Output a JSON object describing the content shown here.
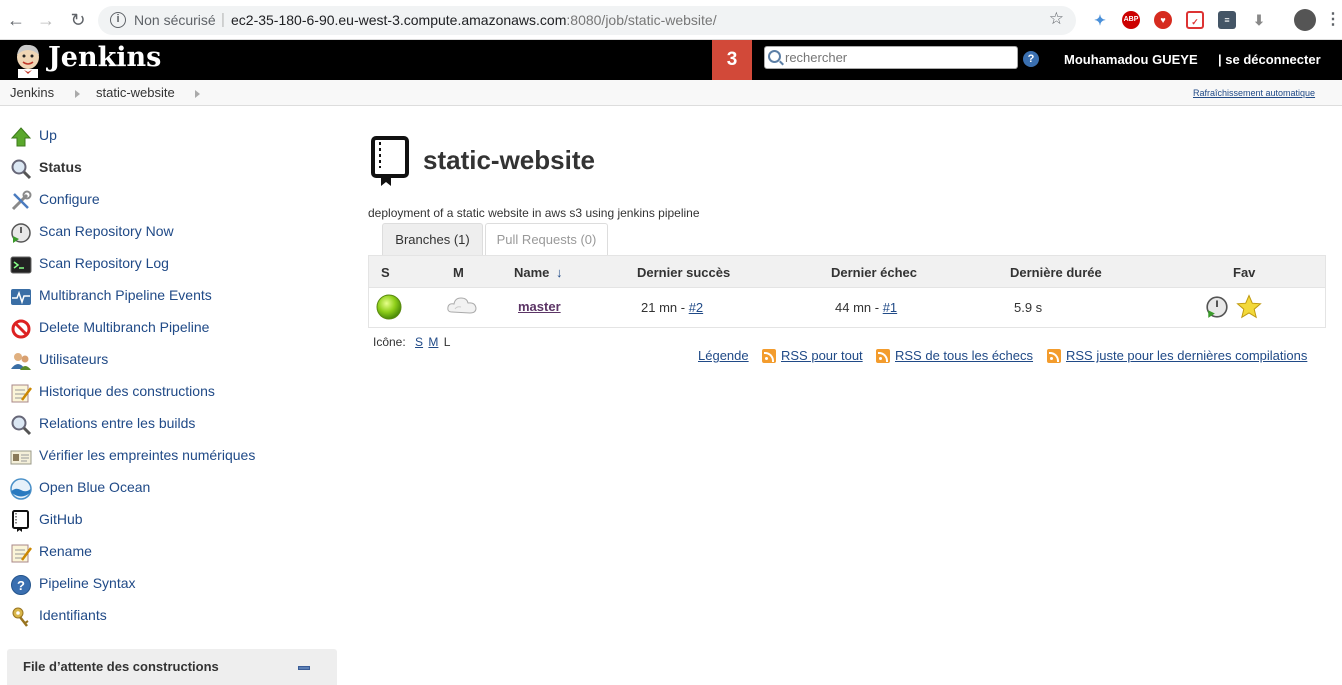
{
  "browser": {
    "security_label": "Non sécurisé",
    "url_host": "ec2-35-180-6-90.eu-west-3.compute.amazonaws.com",
    "url_path": ":8080/job/static-website/"
  },
  "header": {
    "title": "Jenkins",
    "notification_count": "3",
    "search_placeholder": "rechercher",
    "help": "?",
    "user": "Mouhamadou GUEYE",
    "logout": "| se déconnecter"
  },
  "breadcrumb": {
    "items": [
      "Jenkins",
      "static-website"
    ],
    "auto_refresh": "Rafraîchissement automatique"
  },
  "sidebar": {
    "items": [
      {
        "label": "Up",
        "icon": "up-arrow-icon"
      },
      {
        "label": "Status",
        "icon": "magnifier-icon"
      },
      {
        "label": "Configure",
        "icon": "wrench-screwdriver-icon"
      },
      {
        "label": "Scan Repository Now",
        "icon": "clock-play-icon"
      },
      {
        "label": "Scan Repository Log",
        "icon": "terminal-icon"
      },
      {
        "label": "Multibranch Pipeline Events",
        "icon": "pulse-monitor-icon"
      },
      {
        "label": "Delete Multibranch Pipeline",
        "icon": "no-entry-icon"
      },
      {
        "label": "Utilisateurs",
        "icon": "users-icon"
      },
      {
        "label": "Historique des constructions",
        "icon": "notepad-icon"
      },
      {
        "label": "Relations entre les builds",
        "icon": "magnifier-icon"
      },
      {
        "label": "Vérifier les empreintes numériques",
        "icon": "fingerprint-card-icon"
      },
      {
        "label": "Open Blue Ocean",
        "icon": "blue-ocean-icon"
      },
      {
        "label": "GitHub",
        "icon": "repo-book-icon"
      },
      {
        "label": "Rename",
        "icon": "notepad-icon"
      },
      {
        "label": "Pipeline Syntax",
        "icon": "help-circle-icon"
      },
      {
        "label": "Identifiants",
        "icon": "keys-icon"
      }
    ],
    "queue_title": "File d’attente des constructions"
  },
  "main": {
    "title": "static-website",
    "description": "deployment of a static website in aws s3 using jenkins pipeline",
    "tabs": [
      {
        "label": "Branches (1)",
        "active": true
      },
      {
        "label": "Pull Requests (0)",
        "active": false
      }
    ],
    "table": {
      "columns": [
        "S",
        "M",
        "Name",
        "↓",
        "Dernier succès",
        "Dernier échec",
        "Dernière durée",
        "Fav"
      ],
      "rows": [
        {
          "status_color": "#7fbf18",
          "weather": "cloudy-icon",
          "name": "master",
          "last_success": "21 mn - ",
          "last_success_build": "#2",
          "last_failure": "44 mn - ",
          "last_failure_build": "#1",
          "duration": "5.9 s"
        }
      ]
    },
    "icon_size": {
      "label": "Icône:",
      "small": "S",
      "medium": "M",
      "large": "L"
    },
    "footer_links": {
      "legend": "Légende",
      "rss_all": "RSS pour tout",
      "rss_failures": "RSS de tous les échecs",
      "rss_latest": "RSS juste pour les dernières compilations"
    }
  },
  "colors": {
    "header_bg": "#000000",
    "badge": "#d24939",
    "link": "#204a87"
  }
}
